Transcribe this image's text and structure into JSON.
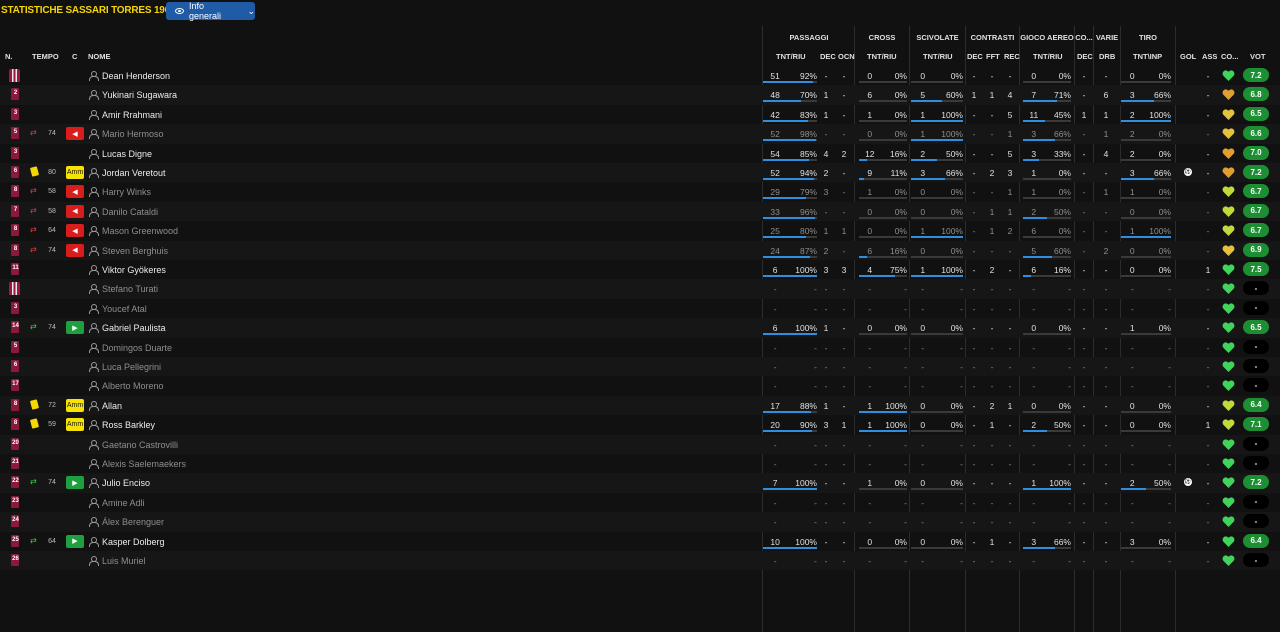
{
  "header": {
    "title": "STATISTICHE SASSARI TORRES 1903",
    "view_button": "Info generali"
  },
  "groups": {
    "passaggi": "PASSAGGI",
    "cross": "CROSS",
    "scivolate": "SCIVOLATE",
    "contrasti": "CONTRASTI",
    "gioco_aereo": "GIOCO AEREO",
    "co": "CO...",
    "varie": "VARIE",
    "tiro": "TIRO"
  },
  "columns": {
    "n": "N.",
    "tempo": "TEMPO",
    "c": "C",
    "nome": "NOME",
    "pass_tnt": "TNT/RIU",
    "pass_dec": "DEC",
    "pass_ocn": "OCN",
    "cross_tnt": "TNT/RIU",
    "sciv_tnt": "TNT/RIU",
    "con_dec": "DEC",
    "con_fft": "FFT",
    "con_rec": "REC",
    "aer_tnt": "TNT/RIU",
    "co_dec": "DEC",
    "drb": "DRB",
    "tiro_tnt": "TNT\\INP",
    "gol": "GOL",
    "ass": "ASS",
    "co2": "CO...",
    "vot": "VOT"
  },
  "colors": {
    "accent_title": "#f5d600",
    "button_blue": "#1f5ba6",
    "bar_blue": "#2e8fe0",
    "rating_green": "#1c8f33",
    "sub_out_red": "#d91c1c",
    "sub_in_green": "#1fa040",
    "card_yellow": "#f7e300"
  },
  "players": [
    {
      "num": "1",
      "name": "Dean Henderson",
      "kit": "gk",
      "ev": "",
      "min": "",
      "badge": "",
      "pass": [
        "51",
        "92%"
      ],
      "pass_pct": 0.92,
      "dec": "-",
      "ocn": "-",
      "cross": [
        "0",
        "0%"
      ],
      "cross_pct": 0,
      "sciv": [
        "0",
        "0%"
      ],
      "sciv_pct": 0,
      "cdec": "-",
      "fft": "-",
      "rec": "-",
      "aer": [
        "0",
        "0%"
      ],
      "aer_pct": 0,
      "codec": "-",
      "drb": "-",
      "tiro": [
        "0",
        "0%"
      ],
      "gol": "",
      "ass": "-",
      "morale": "green",
      "vot": "7.2",
      "dim": false
    },
    {
      "num": "2",
      "name": "Yukinari Sugawara",
      "kit": "out",
      "ev": "",
      "min": "",
      "badge": "",
      "pass": [
        "48",
        "70%"
      ],
      "pass_pct": 0.7,
      "dec": "1",
      "ocn": "-",
      "cross": [
        "6",
        "0%"
      ],
      "cross_pct": 0,
      "sciv": [
        "5",
        "60%"
      ],
      "sciv_pct": 0.6,
      "cdec": "1",
      "fft": "1",
      "rec": "4",
      "aer": [
        "7",
        "71%"
      ],
      "aer_pct": 0.71,
      "codec": "-",
      "drb": "6",
      "tiro": [
        "3",
        "66%"
      ],
      "gol": "",
      "ass": "-",
      "morale": "orange",
      "vot": "6.8",
      "dim": false
    },
    {
      "num": "3",
      "name": "Amir Rrahmani",
      "kit": "out",
      "ev": "",
      "min": "",
      "badge": "",
      "pass": [
        "42",
        "83%"
      ],
      "pass_pct": 0.83,
      "dec": "1",
      "ocn": "-",
      "cross": [
        "1",
        "0%"
      ],
      "cross_pct": 0,
      "sciv": [
        "1",
        "100%"
      ],
      "sciv_pct": 1,
      "cdec": "-",
      "fft": "-",
      "rec": "5",
      "aer": [
        "11",
        "45%"
      ],
      "aer_pct": 0.45,
      "codec": "1",
      "drb": "1",
      "tiro": [
        "2",
        "100%"
      ],
      "gol": "",
      "ass": "-",
      "morale": "yellow",
      "vot": "6.5",
      "dim": false
    },
    {
      "num": "5",
      "name": "Mario Hermoso",
      "kit": "out",
      "ev": "out",
      "min": "74",
      "badge": "red",
      "pass": [
        "52",
        "98%"
      ],
      "pass_pct": 0.98,
      "dec": "-",
      "ocn": "-",
      "cross": [
        "0",
        "0%"
      ],
      "cross_pct": 0,
      "sciv": [
        "1",
        "100%"
      ],
      "sciv_pct": 1,
      "cdec": "-",
      "fft": "-",
      "rec": "1",
      "aer": [
        "3",
        "66%"
      ],
      "aer_pct": 0.66,
      "codec": "-",
      "drb": "1",
      "tiro": [
        "2",
        "0%"
      ],
      "gol": "",
      "ass": "-",
      "morale": "yellow",
      "vot": "6.6",
      "dim": true
    },
    {
      "num": "3",
      "name": "Lucas Digne",
      "kit": "out",
      "ev": "",
      "min": "",
      "badge": "",
      "pass": [
        "54",
        "85%"
      ],
      "pass_pct": 0.85,
      "dec": "4",
      "ocn": "2",
      "cross": [
        "12",
        "16%"
      ],
      "cross_pct": 0.16,
      "sciv": [
        "2",
        "50%"
      ],
      "sciv_pct": 0.5,
      "cdec": "-",
      "fft": "-",
      "rec": "5",
      "aer": [
        "3",
        "33%"
      ],
      "aer_pct": 0.33,
      "codec": "-",
      "drb": "4",
      "tiro": [
        "2",
        "0%"
      ],
      "gol": "",
      "ass": "-",
      "morale": "orange",
      "vot": "7.0",
      "dim": false
    },
    {
      "num": "6",
      "name": "Jordan Veretout",
      "kit": "out",
      "ev": "yellow",
      "min": "80",
      "badge": "amm",
      "pass": [
        "52",
        "94%"
      ],
      "pass_pct": 0.94,
      "dec": "2",
      "ocn": "-",
      "cross": [
        "9",
        "11%"
      ],
      "cross_pct": 0.11,
      "sciv": [
        "3",
        "66%"
      ],
      "sciv_pct": 0.66,
      "cdec": "-",
      "fft": "2",
      "rec": "3",
      "aer": [
        "1",
        "0%"
      ],
      "aer_pct": 0,
      "codec": "-",
      "drb": "-",
      "tiro": [
        "3",
        "66%"
      ],
      "gol": "ball",
      "ass": "-",
      "morale": "orange",
      "vot": "7.2",
      "dim": false
    },
    {
      "num": "8",
      "name": "Harry Winks",
      "kit": "out",
      "ev": "out",
      "min": "58",
      "badge": "red",
      "pass": [
        "29",
        "79%"
      ],
      "pass_pct": 0.79,
      "dec": "3",
      "ocn": "-",
      "cross": [
        "1",
        "0%"
      ],
      "cross_pct": 0,
      "sciv": [
        "0",
        "0%"
      ],
      "sciv_pct": 0,
      "cdec": "-",
      "fft": "-",
      "rec": "1",
      "aer": [
        "1",
        "0%"
      ],
      "aer_pct": 0,
      "codec": "-",
      "drb": "1",
      "tiro": [
        "1",
        "0%"
      ],
      "gol": "",
      "ass": "-",
      "morale": "lime",
      "vot": "6.7",
      "dim": true
    },
    {
      "num": "7",
      "name": "Danilo Cataldi",
      "kit": "out",
      "ev": "out",
      "min": "58",
      "badge": "red",
      "pass": [
        "33",
        "96%"
      ],
      "pass_pct": 0.96,
      "dec": "-",
      "ocn": "-",
      "cross": [
        "0",
        "0%"
      ],
      "cross_pct": 0,
      "sciv": [
        "0",
        "0%"
      ],
      "sciv_pct": 0,
      "cdec": "-",
      "fft": "1",
      "rec": "1",
      "aer": [
        "2",
        "50%"
      ],
      "aer_pct": 0.5,
      "codec": "-",
      "drb": "-",
      "tiro": [
        "0",
        "0%"
      ],
      "gol": "",
      "ass": "-",
      "morale": "lime",
      "vot": "6.7",
      "dim": true
    },
    {
      "num": "8",
      "name": "Mason Greenwood",
      "kit": "out",
      "ev": "out",
      "min": "64",
      "badge": "red",
      "pass": [
        "25",
        "80%"
      ],
      "pass_pct": 0.8,
      "dec": "1",
      "ocn": "1",
      "cross": [
        "0",
        "0%"
      ],
      "cross_pct": 0,
      "sciv": [
        "1",
        "100%"
      ],
      "sciv_pct": 1,
      "cdec": "-",
      "fft": "1",
      "rec": "2",
      "aer": [
        "6",
        "0%"
      ],
      "aer_pct": 0,
      "codec": "-",
      "drb": "-",
      "tiro": [
        "1",
        "100%"
      ],
      "gol": "",
      "ass": "-",
      "morale": "lime",
      "vot": "6.7",
      "dim": true
    },
    {
      "num": "8",
      "name": "Steven Berghuis",
      "kit": "out",
      "ev": "out",
      "min": "74",
      "badge": "red",
      "pass": [
        "24",
        "87%"
      ],
      "pass_pct": 0.87,
      "dec": "2",
      "ocn": "-",
      "cross": [
        "6",
        "16%"
      ],
      "cross_pct": 0.16,
      "sciv": [
        "0",
        "0%"
      ],
      "sciv_pct": 0,
      "cdec": "-",
      "fft": "-",
      "rec": "-",
      "aer": [
        "5",
        "60%"
      ],
      "aer_pct": 0.6,
      "codec": "-",
      "drb": "2",
      "tiro": [
        "0",
        "0%"
      ],
      "gol": "",
      "ass": "-",
      "morale": "yellow",
      "vot": "6.9",
      "dim": true
    },
    {
      "num": "11",
      "name": "Viktor Gyökeres",
      "kit": "out",
      "ev": "",
      "min": "",
      "badge": "",
      "pass": [
        "6",
        "100%"
      ],
      "pass_pct": 1,
      "dec": "3",
      "ocn": "3",
      "cross": [
        "4",
        "75%"
      ],
      "cross_pct": 0.75,
      "sciv": [
        "1",
        "100%"
      ],
      "sciv_pct": 1,
      "cdec": "-",
      "fft": "2",
      "rec": "-",
      "aer": [
        "6",
        "16%"
      ],
      "aer_pct": 0.16,
      "codec": "-",
      "drb": "-",
      "tiro": [
        "0",
        "0%"
      ],
      "gol": "",
      "ass": "1",
      "morale": "green",
      "vot": "7.5",
      "dim": false
    },
    {
      "num": "12",
      "name": "Stefano Turati",
      "kit": "gk",
      "ev": "",
      "min": "",
      "badge": "",
      "pass": [
        "-",
        "-"
      ],
      "pass_pct": 0,
      "dec": "-",
      "ocn": "-",
      "cross": [
        "-",
        "-"
      ],
      "cross_pct": 0,
      "sciv": [
        "-",
        "-"
      ],
      "sciv_pct": 0,
      "cdec": "-",
      "fft": "-",
      "rec": "-",
      "aer": [
        "-",
        "-"
      ],
      "aer_pct": 0,
      "codec": "-",
      "drb": "-",
      "tiro": [
        "-",
        "-"
      ],
      "gol": "",
      "ass": "-",
      "morale": "green",
      "vot": "-",
      "dim": true
    },
    {
      "num": "3",
      "name": "Youcef Atal",
      "kit": "out",
      "ev": "",
      "min": "",
      "badge": "",
      "pass": [
        "-",
        "-"
      ],
      "pass_pct": 0,
      "dec": "-",
      "ocn": "-",
      "cross": [
        "-",
        "-"
      ],
      "cross_pct": 0,
      "sciv": [
        "-",
        "-"
      ],
      "sciv_pct": 0,
      "cdec": "-",
      "fft": "-",
      "rec": "-",
      "aer": [
        "-",
        "-"
      ],
      "aer_pct": 0,
      "codec": "-",
      "drb": "-",
      "tiro": [
        "-",
        "-"
      ],
      "gol": "",
      "ass": "-",
      "morale": "green",
      "vot": "-",
      "dim": true
    },
    {
      "num": "14",
      "name": "Gabriel Paulista",
      "kit": "out",
      "ev": "in",
      "min": "74",
      "badge": "green",
      "pass": [
        "6",
        "100%"
      ],
      "pass_pct": 1,
      "dec": "1",
      "ocn": "-",
      "cross": [
        "0",
        "0%"
      ],
      "cross_pct": 0,
      "sciv": [
        "0",
        "0%"
      ],
      "sciv_pct": 0,
      "cdec": "-",
      "fft": "-",
      "rec": "-",
      "aer": [
        "0",
        "0%"
      ],
      "aer_pct": 0,
      "codec": "-",
      "drb": "-",
      "tiro": [
        "1",
        "0%"
      ],
      "gol": "",
      "ass": "-",
      "morale": "green",
      "vot": "6.5",
      "dim": false
    },
    {
      "num": "5",
      "name": "Domingos Duarte",
      "kit": "out",
      "ev": "",
      "min": "",
      "badge": "",
      "pass": [
        "-",
        "-"
      ],
      "pass_pct": 0,
      "dec": "-",
      "ocn": "-",
      "cross": [
        "-",
        "-"
      ],
      "cross_pct": 0,
      "sciv": [
        "-",
        "-"
      ],
      "sciv_pct": 0,
      "cdec": "-",
      "fft": "-",
      "rec": "-",
      "aer": [
        "-",
        "-"
      ],
      "aer_pct": 0,
      "codec": "-",
      "drb": "-",
      "tiro": [
        "-",
        "-"
      ],
      "gol": "",
      "ass": "-",
      "morale": "green",
      "vot": "-",
      "dim": true
    },
    {
      "num": "6",
      "name": "Luca Pellegrini",
      "kit": "out",
      "ev": "",
      "min": "",
      "badge": "",
      "pass": [
        "-",
        "-"
      ],
      "pass_pct": 0,
      "dec": "-",
      "ocn": "-",
      "cross": [
        "-",
        "-"
      ],
      "cross_pct": 0,
      "sciv": [
        "-",
        "-"
      ],
      "sciv_pct": 0,
      "cdec": "-",
      "fft": "-",
      "rec": "-",
      "aer": [
        "-",
        "-"
      ],
      "aer_pct": 0,
      "codec": "-",
      "drb": "-",
      "tiro": [
        "-",
        "-"
      ],
      "gol": "",
      "ass": "-",
      "morale": "green",
      "vot": "-",
      "dim": true
    },
    {
      "num": "17",
      "name": "Alberto Moreno",
      "kit": "out",
      "ev": "",
      "min": "",
      "badge": "",
      "pass": [
        "-",
        "-"
      ],
      "pass_pct": 0,
      "dec": "-",
      "ocn": "-",
      "cross": [
        "-",
        "-"
      ],
      "cross_pct": 0,
      "sciv": [
        "-",
        "-"
      ],
      "sciv_pct": 0,
      "cdec": "-",
      "fft": "-",
      "rec": "-",
      "aer": [
        "-",
        "-"
      ],
      "aer_pct": 0,
      "codec": "-",
      "drb": "-",
      "tiro": [
        "-",
        "-"
      ],
      "gol": "",
      "ass": "-",
      "morale": "green",
      "vot": "-",
      "dim": true
    },
    {
      "num": "8",
      "name": "Allan",
      "kit": "out",
      "ev": "yellow",
      "min": "72",
      "badge": "amm",
      "pass": [
        "17",
        "88%"
      ],
      "pass_pct": 0.88,
      "dec": "1",
      "ocn": "-",
      "cross": [
        "1",
        "100%"
      ],
      "cross_pct": 1,
      "sciv": [
        "0",
        "0%"
      ],
      "sciv_pct": 0,
      "cdec": "-",
      "fft": "2",
      "rec": "1",
      "aer": [
        "0",
        "0%"
      ],
      "aer_pct": 0,
      "codec": "-",
      "drb": "-",
      "tiro": [
        "0",
        "0%"
      ],
      "gol": "",
      "ass": "-",
      "morale": "lime",
      "vot": "6.4",
      "dim": false
    },
    {
      "num": "8",
      "name": "Ross Barkley",
      "kit": "out",
      "ev": "yellow",
      "min": "59",
      "badge": "amm",
      "pass": [
        "20",
        "90%"
      ],
      "pass_pct": 0.9,
      "dec": "3",
      "ocn": "1",
      "cross": [
        "1",
        "100%"
      ],
      "cross_pct": 1,
      "sciv": [
        "0",
        "0%"
      ],
      "sciv_pct": 0,
      "cdec": "-",
      "fft": "1",
      "rec": "-",
      "aer": [
        "2",
        "50%"
      ],
      "aer_pct": 0.5,
      "codec": "-",
      "drb": "-",
      "tiro": [
        "0",
        "0%"
      ],
      "gol": "",
      "ass": "1",
      "morale": "lime",
      "vot": "7.1",
      "dim": false
    },
    {
      "num": "20",
      "name": "Gaetano Castrovilli",
      "kit": "out",
      "ev": "",
      "min": "",
      "badge": "",
      "pass": [
        "-",
        "-"
      ],
      "pass_pct": 0,
      "dec": "-",
      "ocn": "-",
      "cross": [
        "-",
        "-"
      ],
      "cross_pct": 0,
      "sciv": [
        "-",
        "-"
      ],
      "sciv_pct": 0,
      "cdec": "-",
      "fft": "-",
      "rec": "-",
      "aer": [
        "-",
        "-"
      ],
      "aer_pct": 0,
      "codec": "-",
      "drb": "-",
      "tiro": [
        "-",
        "-"
      ],
      "gol": "",
      "ass": "-",
      "morale": "green",
      "vot": "-",
      "dim": true
    },
    {
      "num": "21",
      "name": "Alexis Saelemaekers",
      "kit": "out",
      "ev": "",
      "min": "",
      "badge": "",
      "pass": [
        "-",
        "-"
      ],
      "pass_pct": 0,
      "dec": "-",
      "ocn": "-",
      "cross": [
        "-",
        "-"
      ],
      "cross_pct": 0,
      "sciv": [
        "-",
        "-"
      ],
      "sciv_pct": 0,
      "cdec": "-",
      "fft": "-",
      "rec": "-",
      "aer": [
        "-",
        "-"
      ],
      "aer_pct": 0,
      "codec": "-",
      "drb": "-",
      "tiro": [
        "-",
        "-"
      ],
      "gol": "",
      "ass": "-",
      "morale": "green",
      "vot": "-",
      "dim": true
    },
    {
      "num": "22",
      "name": "Julio Enciso",
      "kit": "out",
      "ev": "in",
      "min": "74",
      "badge": "green",
      "pass": [
        "7",
        "100%"
      ],
      "pass_pct": 1,
      "dec": "-",
      "ocn": "-",
      "cross": [
        "1",
        "0%"
      ],
      "cross_pct": 0,
      "sciv": [
        "0",
        "0%"
      ],
      "sciv_pct": 0,
      "cdec": "-",
      "fft": "-",
      "rec": "-",
      "aer": [
        "1",
        "100%"
      ],
      "aer_pct": 1,
      "codec": "-",
      "drb": "-",
      "tiro": [
        "2",
        "50%"
      ],
      "gol": "ball",
      "ass": "-",
      "morale": "green",
      "vot": "7.2",
      "dim": false
    },
    {
      "num": "23",
      "name": "Amine Adli",
      "kit": "out",
      "ev": "",
      "min": "",
      "badge": "",
      "pass": [
        "-",
        "-"
      ],
      "pass_pct": 0,
      "dec": "-",
      "ocn": "-",
      "cross": [
        "-",
        "-"
      ],
      "cross_pct": 0,
      "sciv": [
        "-",
        "-"
      ],
      "sciv_pct": 0,
      "cdec": "-",
      "fft": "-",
      "rec": "-",
      "aer": [
        "-",
        "-"
      ],
      "aer_pct": 0,
      "codec": "-",
      "drb": "-",
      "tiro": [
        "-",
        "-"
      ],
      "gol": "",
      "ass": "-",
      "morale": "green",
      "vot": "-",
      "dim": true
    },
    {
      "num": "24",
      "name": "Álex Berenguer",
      "kit": "out",
      "ev": "",
      "min": "",
      "badge": "",
      "pass": [
        "-",
        "-"
      ],
      "pass_pct": 0,
      "dec": "-",
      "ocn": "-",
      "cross": [
        "-",
        "-"
      ],
      "cross_pct": 0,
      "sciv": [
        "-",
        "-"
      ],
      "sciv_pct": 0,
      "cdec": "-",
      "fft": "-",
      "rec": "-",
      "aer": [
        "-",
        "-"
      ],
      "aer_pct": 0,
      "codec": "-",
      "drb": "-",
      "tiro": [
        "-",
        "-"
      ],
      "gol": "",
      "ass": "-",
      "morale": "green",
      "vot": "-",
      "dim": true
    },
    {
      "num": "25",
      "name": "Kasper Dolberg",
      "kit": "out",
      "ev": "in",
      "min": "64",
      "badge": "green",
      "pass": [
        "10",
        "100%"
      ],
      "pass_pct": 1,
      "dec": "-",
      "ocn": "-",
      "cross": [
        "0",
        "0%"
      ],
      "cross_pct": 0,
      "sciv": [
        "0",
        "0%"
      ],
      "sciv_pct": 0,
      "cdec": "-",
      "fft": "1",
      "rec": "-",
      "aer": [
        "3",
        "66%"
      ],
      "aer_pct": 0.66,
      "codec": "-",
      "drb": "-",
      "tiro": [
        "3",
        "0%"
      ],
      "gol": "",
      "ass": "-",
      "morale": "green",
      "vot": "6.4",
      "dim": false
    },
    {
      "num": "26",
      "name": "Luis Muriel",
      "kit": "out",
      "ev": "",
      "min": "",
      "badge": "",
      "pass": [
        "-",
        "-"
      ],
      "pass_pct": 0,
      "dec": "-",
      "ocn": "-",
      "cross": [
        "-",
        "-"
      ],
      "cross_pct": 0,
      "sciv": [
        "-",
        "-"
      ],
      "sciv_pct": 0,
      "cdec": "-",
      "fft": "-",
      "rec": "-",
      "aer": [
        "-",
        "-"
      ],
      "aer_pct": 0,
      "codec": "-",
      "drb": "-",
      "tiro": [
        "-",
        "-"
      ],
      "gol": "",
      "ass": "-",
      "morale": "green",
      "vot": "-",
      "dim": true
    }
  ]
}
